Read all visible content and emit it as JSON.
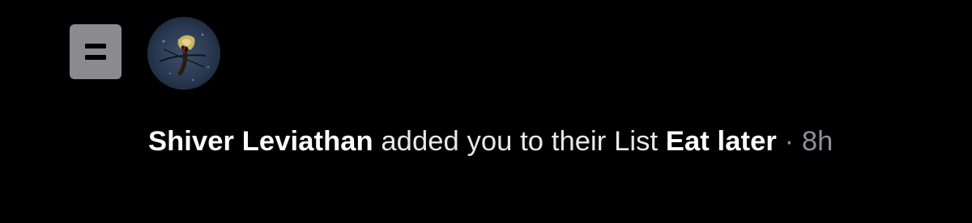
{
  "notification": {
    "icon": "list-icon",
    "avatar": {
      "name": "avatar",
      "alt_label": "Shiver Leviathan avatar"
    },
    "actor_name": "Shiver Leviathan",
    "action_text": " added you to their List ",
    "list_name": "Eat later",
    "separator": " · ",
    "timestamp": "8h"
  },
  "colors": {
    "background": "#000000",
    "text_primary": "#e7e9ea",
    "text_secondary": "#8b9095",
    "icon_bg": "#8b8b8f"
  }
}
